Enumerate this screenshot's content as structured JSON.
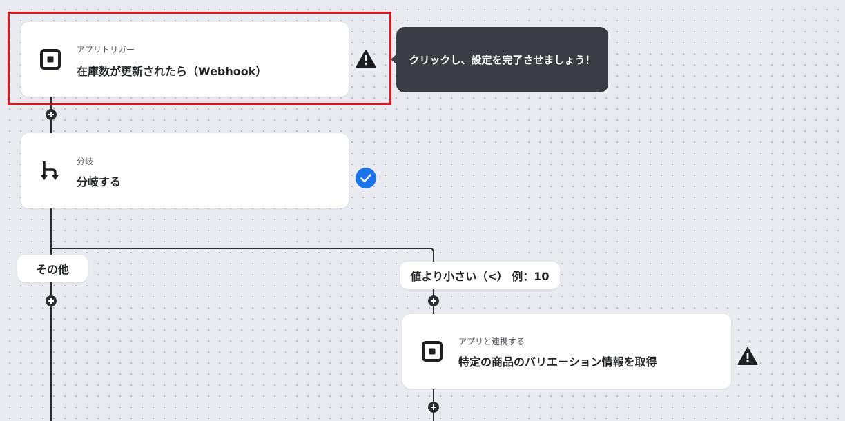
{
  "nodes": {
    "trigger": {
      "sub": "アプリトリガー",
      "title": "在庫数が更新されたら（Webhook）",
      "icon": "square-logo-icon",
      "status": "warning-icon"
    },
    "branch": {
      "sub": "分岐",
      "title": "分岐する",
      "icon": "branch-icon",
      "status": "check-circle-icon"
    },
    "action": {
      "sub": "アプリと連携する",
      "title": "特定の商品のバリエーション情報を取得",
      "icon": "square-logo-icon",
      "status": "warning-icon"
    }
  },
  "tooltip": {
    "text": "クリックし、設定を完了させましょう！"
  },
  "branches": {
    "other_label": "その他",
    "condition_label": "値より小さい（<） 例：10"
  },
  "colors": {
    "highlight": "#e0161e",
    "check": "#1a73e8",
    "tooltip_bg": "#3a3d44",
    "connector": "#2b2d31"
  }
}
